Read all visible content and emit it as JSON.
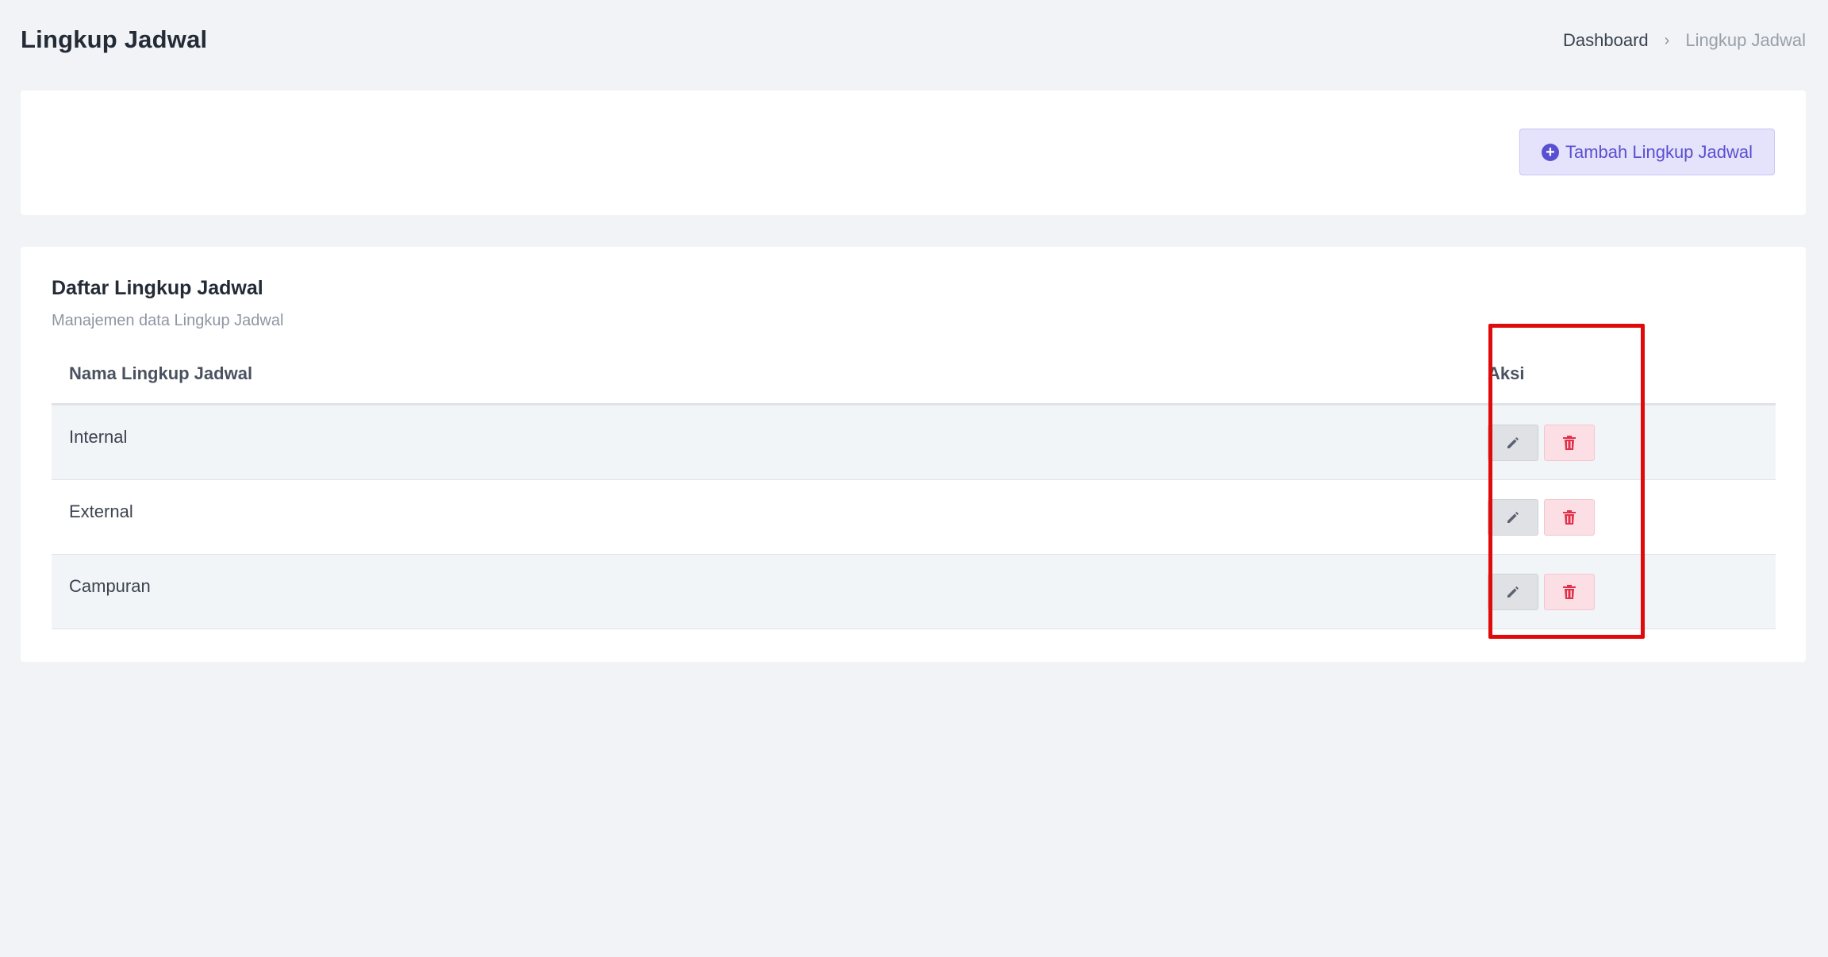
{
  "page": {
    "title": "Lingkup Jadwal",
    "breadcrumb": {
      "items": [
        "Dashboard",
        "Lingkup Jadwal"
      ],
      "separator": "›"
    }
  },
  "toolbar": {
    "add_label": "Tambah Lingkup Jadwal",
    "add_icon": "plus-circle-icon"
  },
  "list": {
    "title": "Daftar Lingkup Jadwal",
    "subtitle": "Manajemen data Lingkup Jadwal",
    "columns": [
      "Nama Lingkup Jadwal",
      "Aksi"
    ],
    "rows": [
      {
        "name": "Internal"
      },
      {
        "name": "External"
      },
      {
        "name": "Campuran"
      }
    ],
    "row_actions": {
      "edit_icon": "pencil-icon",
      "delete_icon": "trash-icon"
    }
  },
  "colors": {
    "accent": "#5a4fd0",
    "danger": "#e2314b",
    "highlight": "#e10a0a"
  }
}
